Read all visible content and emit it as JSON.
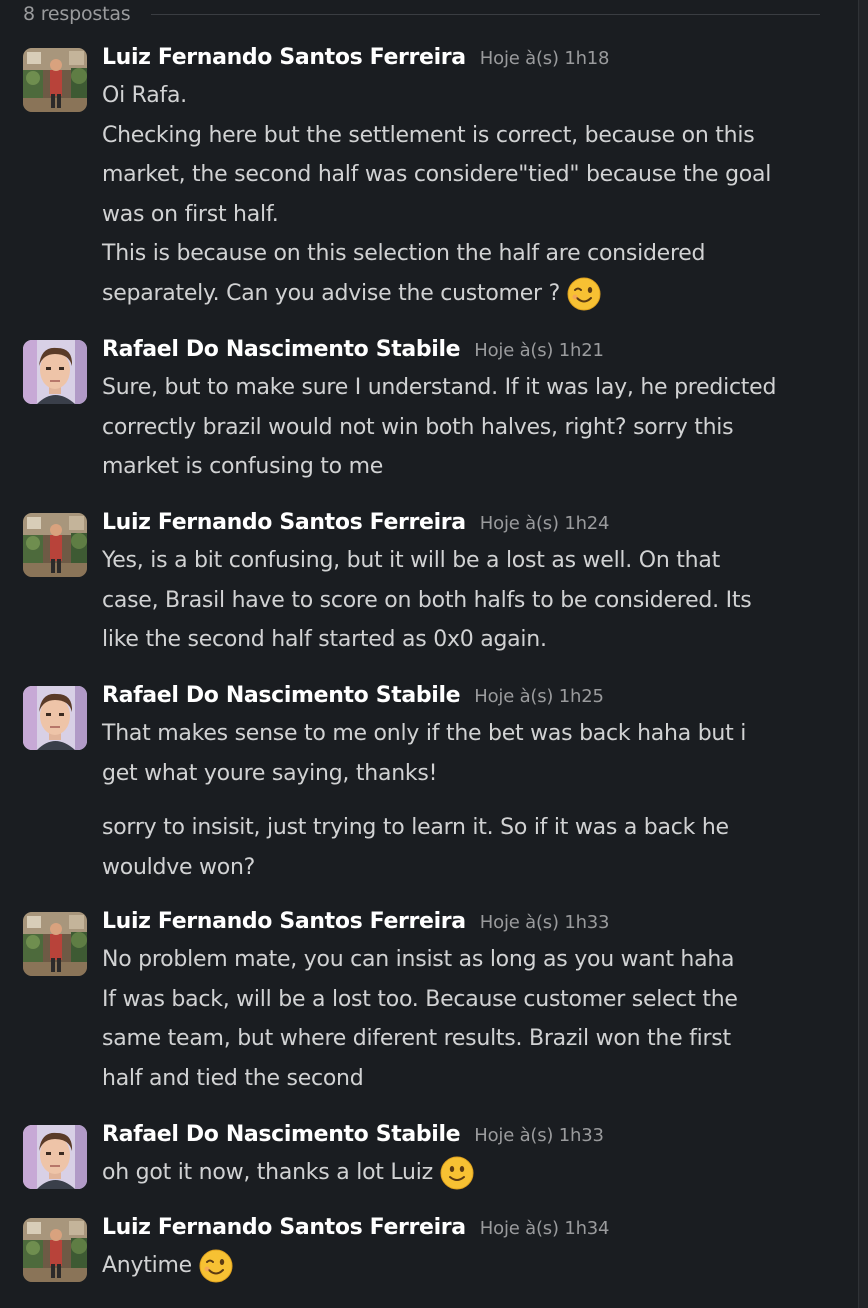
{
  "thread": {
    "replies_label": "8 respostas",
    "messages": [
      {
        "author": "Luiz Fernando Santos Ferreira",
        "time": "Hoje à(s) 1h18",
        "avatar_icon": "avatar-photo-luiz",
        "lines": [
          "Oi Rafa.",
          "Checking here but the settlement is correct, because on this",
          "market, the second half was considere\"tied\" because the goal",
          "was on first half.",
          "This is because on this selection the half are considered",
          "separately. Can you advise the customer ?"
        ],
        "emoji": "winking-face-emoji"
      },
      {
        "author": "Rafael Do Nascimento Stabile",
        "time": "Hoje à(s) 1h21",
        "avatar_icon": "avatar-photo-rafael",
        "lines": [
          "Sure, but to make sure I understand. If it was lay, he predicted",
          "correctly brazil would not win both halves, right? sorry this",
          "market is confusing to me"
        ]
      },
      {
        "author": "Luiz Fernando Santos Ferreira",
        "time": "Hoje à(s) 1h24",
        "avatar_icon": "avatar-photo-luiz",
        "lines": [
          "Yes, is a bit confusing, but it will be a lost as well. On that",
          "case, Brasil have to score on both halfs to be considered. Its",
          "like the second half started as 0x0 again."
        ]
      },
      {
        "author": "Rafael Do Nascimento Stabile",
        "time": "Hoje à(s) 1h25",
        "avatar_icon": "avatar-photo-rafael",
        "lines": [
          "That makes sense to me only if the bet was back haha but i",
          "get what youre saying, thanks!"
        ],
        "followup_lines": [
          "sorry to insisit, just trying to learn it. So if it was a back he",
          "wouldve won?"
        ]
      },
      {
        "author": "Luiz Fernando Santos Ferreira",
        "time": "Hoje à(s) 1h33",
        "avatar_icon": "avatar-photo-luiz",
        "lines": [
          "No problem mate, you can insist as long as you want haha",
          "If was back, will be a lost too. Because customer select the",
          "same team, but where diferent results. Brazil won the first",
          "half and tied the second"
        ]
      },
      {
        "author": "Rafael Do Nascimento Stabile",
        "time": "Hoje à(s) 1h33",
        "avatar_icon": "avatar-photo-rafael",
        "lines": [
          "oh got it now, thanks a lot Luiz"
        ],
        "emoji": "smiling-face-emoji"
      },
      {
        "author": "Luiz Fernando Santos Ferreira",
        "time": "Hoje à(s) 1h34",
        "avatar_icon": "avatar-photo-luiz",
        "lines": [
          "Anytime"
        ],
        "emoji": "winking-face-emoji"
      }
    ]
  },
  "colors": {
    "background": "#1a1d21",
    "text": "#d1d2d3",
    "author": "#ffffff",
    "muted": "#9a9b9d",
    "emoji_yellow": "#f7c133"
  }
}
